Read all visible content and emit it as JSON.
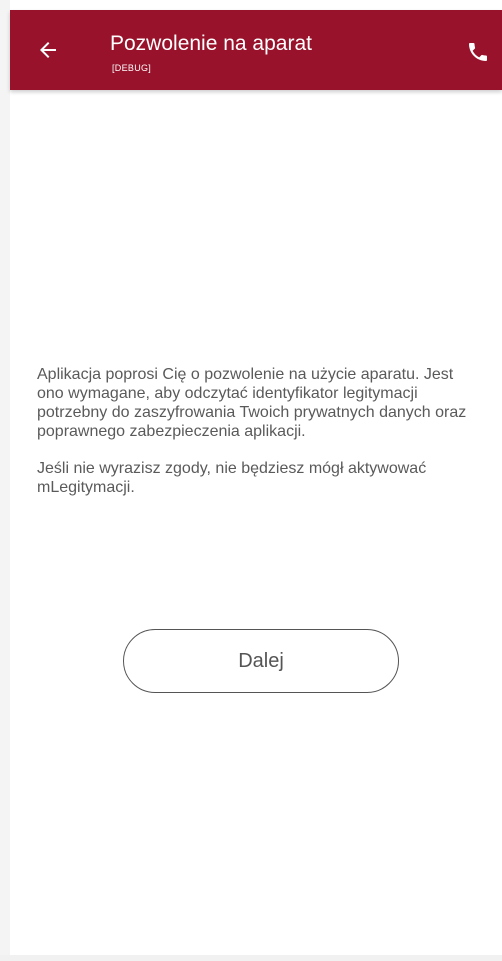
{
  "app_bar": {
    "title": "Pozwolenie na aparat",
    "subtitle": "[DEBUG]",
    "back_icon": "arrow-back-icon",
    "phone_icon": "phone-icon",
    "color": "#97122a"
  },
  "content": {
    "paragraph_1": "Aplikacja poprosi Cię o pozwolenie na użycie aparatu. Jest ono wymagane, aby odczytać identyfikator legitymacji potrzebny do zaszyfrowania Twoich prywatnych danych oraz poprawnego zabezpieczenia aplikacji.",
    "paragraph_2": "Jeśli nie wyrazisz zgody, nie będziesz mógł aktywować mLegitymacji."
  },
  "actions": {
    "next_label": "Dalej"
  }
}
